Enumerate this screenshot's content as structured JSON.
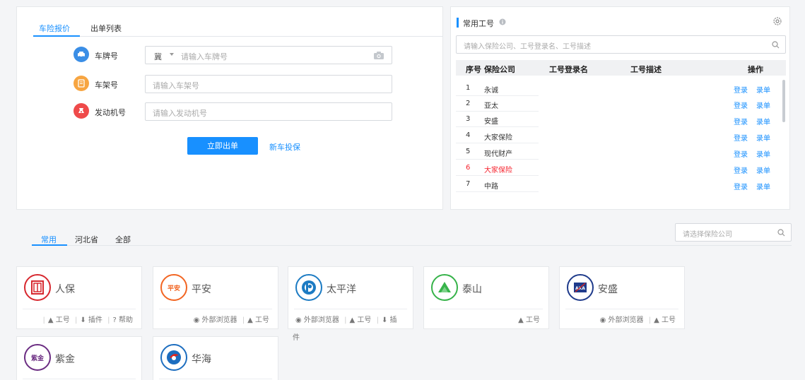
{
  "quote": {
    "tabs": [
      "车险报价",
      "出单列表"
    ],
    "plate": {
      "label": "车牌号",
      "province": "冀",
      "placeholder": "请输入车牌号"
    },
    "frame": {
      "label": "车架号",
      "placeholder": "请输入车架号"
    },
    "engine": {
      "label": "发动机号",
      "placeholder": "请输入发动机号"
    },
    "submit_label": "立即出单",
    "new_car_label": "新车投保"
  },
  "accounts": {
    "title": "常用工号",
    "search_placeholder": "请输入保险公司、工号登录名、工号描述",
    "columns": [
      "序号",
      "保险公司",
      "工号登录名",
      "工号描述",
      "操作"
    ],
    "rows": [
      {
        "no": "1",
        "company": "永诚"
      },
      {
        "no": "2",
        "company": "亚太"
      },
      {
        "no": "3",
        "company": "安盛"
      },
      {
        "no": "4",
        "company": "大家保险"
      },
      {
        "no": "5",
        "company": "现代财产"
      },
      {
        "no": "6",
        "company": "大家保险"
      },
      {
        "no": "7",
        "company": "中路"
      }
    ],
    "op_login": "登录",
    "op_record": "录单"
  },
  "companies": {
    "tabs": [
      "常用",
      "河北省",
      "全部"
    ],
    "search_placeholder": "请选择保险公司",
    "cards": [
      {
        "name": "人保",
        "actions": [
          "工号",
          "插件",
          "帮助"
        ]
      },
      {
        "name": "平安",
        "actions": [
          "外部浏览器",
          "工号"
        ]
      },
      {
        "name": "太平洋",
        "actions": [
          "外部浏览器",
          "工号",
          "插"
        ]
      },
      {
        "name": "泰山",
        "actions": [
          "工号"
        ]
      },
      {
        "name": "安盛",
        "actions": [
          "外部浏览器",
          "工号"
        ]
      },
      {
        "name": "紫金",
        "actions": []
      },
      {
        "name": "华海",
        "actions": []
      }
    ],
    "wrap_text": "件",
    "logo_texts": {
      "pingan": "平安",
      "zijin": "紫金",
      "axa": "AXA"
    }
  },
  "colors": {
    "accent": "#1890ff",
    "danger": "#f5222d"
  }
}
